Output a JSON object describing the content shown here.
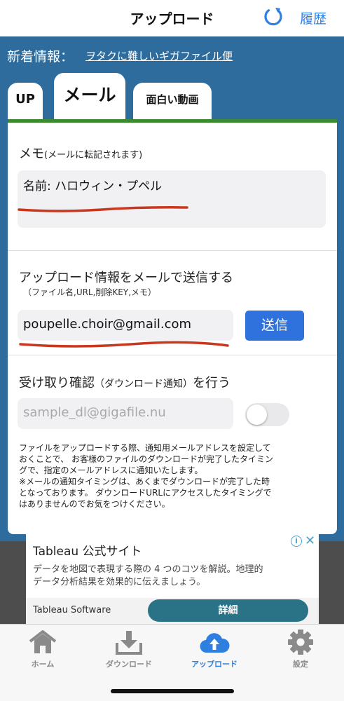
{
  "header": {
    "title": "アップロード",
    "history_label": "履歴"
  },
  "news": {
    "label": "新着情報：",
    "link": "ヲタクに難しいギガファイル便"
  },
  "tabs": [
    {
      "label": "UP"
    },
    {
      "label": "メール"
    },
    {
      "label": "面白い動画"
    }
  ],
  "memo": {
    "label": "メモ",
    "note": "(メールに転記されます)",
    "value": "名前: ハロウィン・プペル"
  },
  "upload_mail": {
    "label": "アップロード情報をメールで送信する",
    "sub": "（ファイル名,URL,削除KEY,メモ）",
    "email": "poupelle.choir@gmail.com",
    "send_label": "送信"
  },
  "receipt": {
    "label_main": "受け取り確認",
    "label_paren": "（ダウンロード通知）",
    "label_tail": "を行う",
    "placeholder": "sample_dl@gigafile.nu",
    "toggle_on": false
  },
  "notice": [
    "ファイルをアップロードする際、通知用メールアドレスを設定して",
    "おくことで、 お客様のファイルのダウンロードが完了したタイミン",
    "グで、指定のメールアドレスに通知いたします。",
    "※メールの通知タイミングは、あくまでダウンロードが完了した時",
    "となっております。 ダウンロードURLにアクセスしたタイミングで",
    "はありませんのでお気をつけください。"
  ],
  "ad": {
    "title": "Tableau 公式サイト",
    "info": "i",
    "close": "✕",
    "desc_1": "データを地図で表現する際の 4 つのコツを解説。地理的",
    "desc_2": "データ分析結果を効果的に伝えましょう。",
    "brand": "Tableau Software",
    "button": "詳細"
  },
  "tabbar": [
    {
      "label": "ホーム",
      "icon": "home-icon",
      "active": false
    },
    {
      "label": "ダウンロード",
      "icon": "download-icon",
      "active": false
    },
    {
      "label": "アップロード",
      "icon": "upload-cloud-icon",
      "active": true
    },
    {
      "label": "設定",
      "icon": "gear-icon",
      "active": false
    }
  ],
  "colors": {
    "accent": "#2f7fe0",
    "band": "#2e6c9d",
    "send_button": "#2f72de",
    "card_border": "#3b8a2e",
    "annotation_red": "#c8371e"
  }
}
